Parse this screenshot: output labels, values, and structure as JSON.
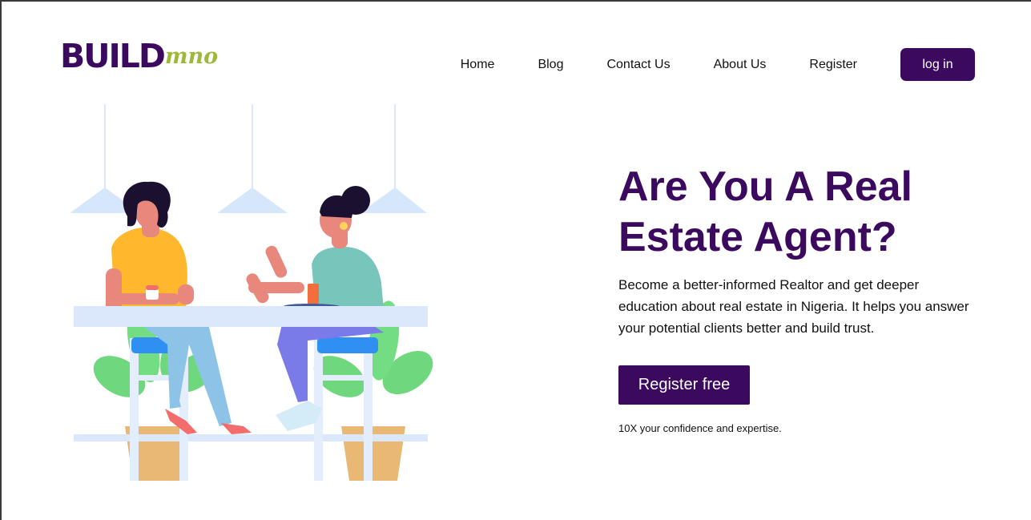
{
  "brand": {
    "main": "BUILD",
    "sub": "mno"
  },
  "nav": {
    "links": [
      "Home",
      "Blog",
      "Contact Us",
      "About Us",
      "Register"
    ],
    "login_label": "log in"
  },
  "hero": {
    "title": "Are You A Real Estate Agent?",
    "description": "Become a better-informed Realtor and get deeper education about real estate in Nigeria. It helps you answer your potential clients better and build trust.",
    "cta_label": "Register free",
    "tagline": "10X your confidence and expertise."
  },
  "colors": {
    "brand_purple": "#3b0a5e",
    "brand_green": "#9fb83c"
  },
  "illustration": "two-women-chatting-at-bar-table"
}
